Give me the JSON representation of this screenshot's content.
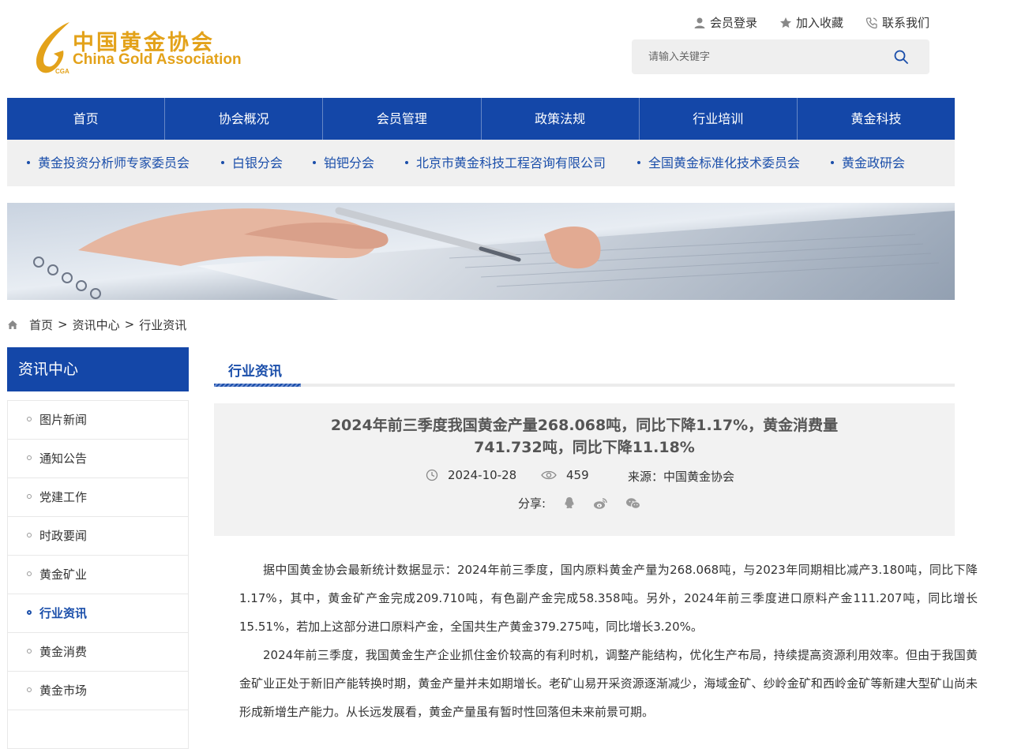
{
  "header": {
    "logo_cn": "中国黄金协会",
    "logo_en": "China Gold Association",
    "logo_abbr": "CGA",
    "top_links": [
      {
        "label": "会员登录",
        "icon": "user-icon"
      },
      {
        "label": "加入收藏",
        "icon": "star-icon"
      },
      {
        "label": "联系我们",
        "icon": "phone-icon"
      }
    ],
    "search": {
      "placeholder": "请输入关键字",
      "icon": "search-icon"
    }
  },
  "main_nav": [
    "首页",
    "协会概况",
    "会员管理",
    "政策法规",
    "行业培训",
    "黄金科技"
  ],
  "sub_nav": [
    "黄金投资分析师专家委员会",
    "白银分会",
    "铂钯分会",
    "北京市黄金科技工程咨询有限公司",
    "全国黄金标准化技术委员会",
    "黄金政研会"
  ],
  "breadcrumb": [
    "首页",
    "资讯中心",
    "行业资讯"
  ],
  "sidebar": {
    "title": "资讯中心",
    "items": [
      "图片新闻",
      "通知公告",
      "党建工作",
      "时政要闻",
      "黄金矿业",
      "行业资讯",
      "黄金消费",
      "黄金市场"
    ],
    "active_index": 5
  },
  "section_tab": "行业资讯",
  "article": {
    "title": "2024年前三季度我国黄金产量268.068吨，同比下降1.17%，黄金消费量741.732吨，同比下降11.18%",
    "date": "2024-10-28",
    "views": "459",
    "source": "来源：中国黄金协会",
    "share_label": "分享:",
    "share_icons": [
      "qq-icon",
      "weibo-icon",
      "wechat-icon"
    ],
    "paragraphs": [
      "据中国黄金协会最新统计数据显示：2024年前三季度，国内原料黄金产量为268.068吨，与2023年同期相比减产3.180吨，同比下降1.17%，其中，黄金矿产金完成209.710吨，有色副产金完成58.358吨。另外，2024年前三季度进口原料产金111.207吨，同比增长15.51%，若加上这部分进口原料产金，全国共生产黄金379.275吨，同比增长3.20%。",
      "2024年前三季度，我国黄金生产企业抓住金价较高的有利时机，调整产能结构，优化生产布局，持续提高资源利用效率。但由于我国黄金矿业正处于新旧产能转换时期，黄金产量并未如期增长。老矿山易开采资源逐渐减少，海域金矿、纱岭金矿和西岭金矿等新建大型矿山尚未形成新增生产能力。从长远发展看，黄金产量虽有暂时性回落但未来前景可期。"
    ]
  },
  "colors": {
    "brand_blue": "#1447a8",
    "gold": "#e3a21a",
    "link_blue": "#1a4eaa"
  }
}
